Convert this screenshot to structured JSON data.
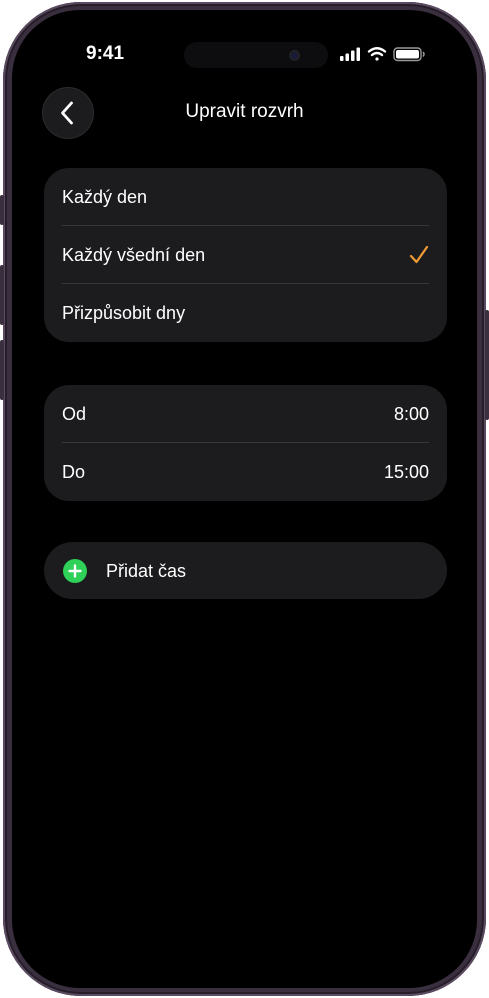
{
  "status_bar": {
    "time": "9:41"
  },
  "nav": {
    "title": "Upravit rozvrh",
    "back_icon": "chevron-left-icon"
  },
  "repeat_options": [
    {
      "label": "Každý den",
      "selected": false
    },
    {
      "label": "Každý všední den",
      "selected": true
    },
    {
      "label": "Přizpůsobit dny",
      "selected": false
    }
  ],
  "time_range": {
    "from_label": "Od",
    "from_value": "8:00",
    "to_label": "Do",
    "to_value": "15:00"
  },
  "add_time": {
    "label": "Přidat čas",
    "icon": "plus-circle-icon"
  },
  "colors": {
    "accent": "#f09a37",
    "add_green": "#30d158",
    "group_bg": "#1c1c1e",
    "background": "#000000"
  }
}
